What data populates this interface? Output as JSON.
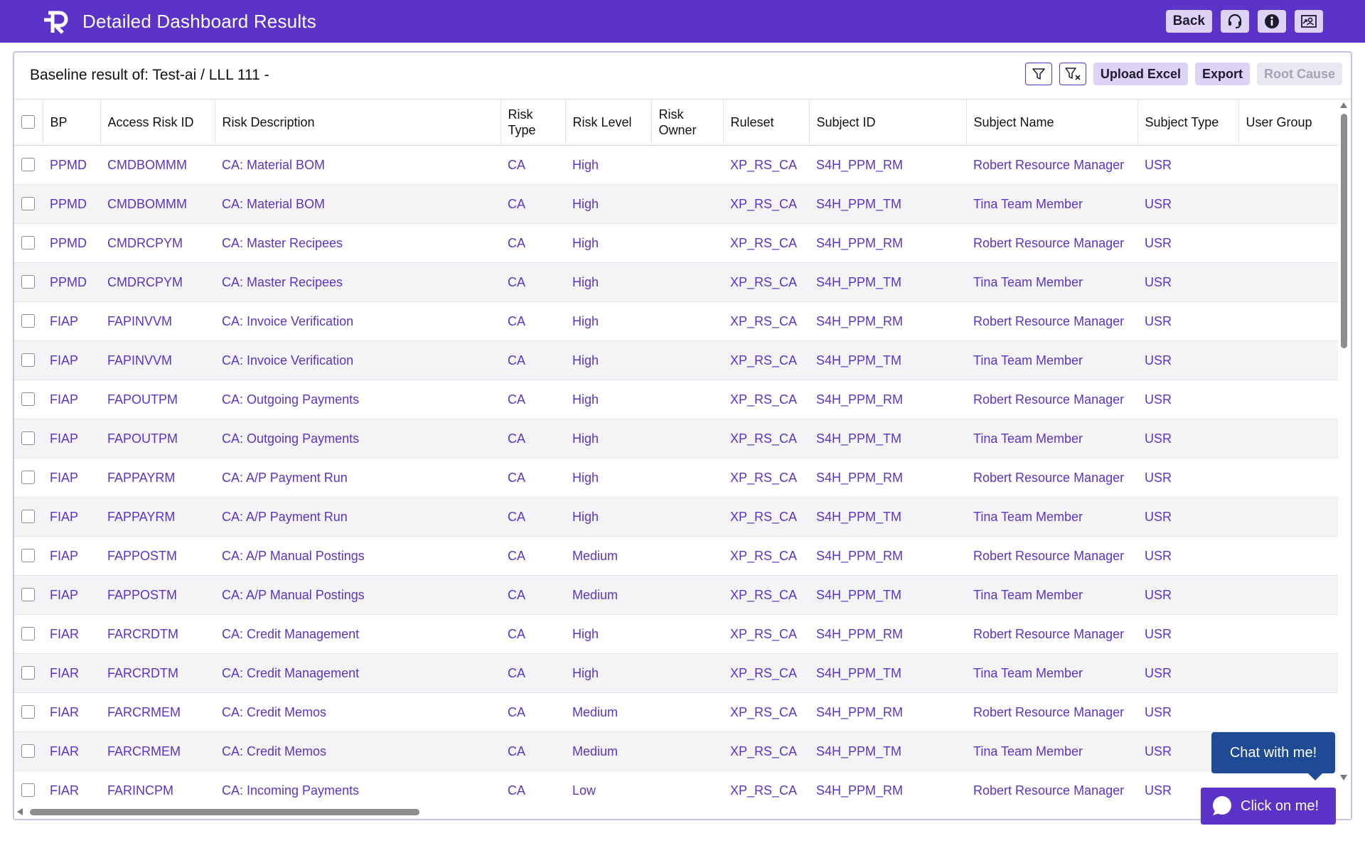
{
  "header": {
    "title": "Detailed Dashboard Results",
    "back_label": "Back"
  },
  "panel": {
    "title": "Baseline result of: Test-ai / LLL 111 -",
    "upload_label": "Upload Excel",
    "export_label": "Export",
    "root_cause_label": "Root Cause"
  },
  "table": {
    "columns": [
      "BP",
      "Access Risk ID",
      "Risk Description",
      "Risk Type",
      "Risk Level",
      "Risk Owner",
      "Ruleset",
      "Subject ID",
      "Subject Name",
      "Subject Type",
      "User Group"
    ],
    "rows": [
      [
        "PPMD",
        "CMDBOMMM",
        "CA: Material BOM",
        "CA",
        "High",
        "",
        "XP_RS_CA",
        "S4H_PPM_RM",
        "Robert Resource Manager",
        "USR",
        ""
      ],
      [
        "PPMD",
        "CMDBOMMM",
        "CA: Material BOM",
        "CA",
        "High",
        "",
        "XP_RS_CA",
        "S4H_PPM_TM",
        "Tina Team Member",
        "USR",
        ""
      ],
      [
        "PPMD",
        "CMDRCPYM",
        "CA: Master Recipees",
        "CA",
        "High",
        "",
        "XP_RS_CA",
        "S4H_PPM_RM",
        "Robert Resource Manager",
        "USR",
        ""
      ],
      [
        "PPMD",
        "CMDRCPYM",
        "CA: Master Recipees",
        "CA",
        "High",
        "",
        "XP_RS_CA",
        "S4H_PPM_TM",
        "Tina Team Member",
        "USR",
        ""
      ],
      [
        "FIAP",
        "FAPINVVM",
        "CA: Invoice Verification",
        "CA",
        "High",
        "",
        "XP_RS_CA",
        "S4H_PPM_RM",
        "Robert Resource Manager",
        "USR",
        ""
      ],
      [
        "FIAP",
        "FAPINVVM",
        "CA: Invoice Verification",
        "CA",
        "High",
        "",
        "XP_RS_CA",
        "S4H_PPM_TM",
        "Tina Team Member",
        "USR",
        ""
      ],
      [
        "FIAP",
        "FAPOUTPM",
        "CA: Outgoing Payments",
        "CA",
        "High",
        "",
        "XP_RS_CA",
        "S4H_PPM_RM",
        "Robert Resource Manager",
        "USR",
        ""
      ],
      [
        "FIAP",
        "FAPOUTPM",
        "CA: Outgoing Payments",
        "CA",
        "High",
        "",
        "XP_RS_CA",
        "S4H_PPM_TM",
        "Tina Team Member",
        "USR",
        ""
      ],
      [
        "FIAP",
        "FAPPAYRM",
        "CA: A/P Payment Run",
        "CA",
        "High",
        "",
        "XP_RS_CA",
        "S4H_PPM_RM",
        "Robert Resource Manager",
        "USR",
        ""
      ],
      [
        "FIAP",
        "FAPPAYRM",
        "CA: A/P Payment Run",
        "CA",
        "High",
        "",
        "XP_RS_CA",
        "S4H_PPM_TM",
        "Tina Team Member",
        "USR",
        ""
      ],
      [
        "FIAP",
        "FAPPOSTM",
        "CA: A/P Manual Postings",
        "CA",
        "Medium",
        "",
        "XP_RS_CA",
        "S4H_PPM_RM",
        "Robert Resource Manager",
        "USR",
        ""
      ],
      [
        "FIAP",
        "FAPPOSTM",
        "CA: A/P Manual Postings",
        "CA",
        "Medium",
        "",
        "XP_RS_CA",
        "S4H_PPM_TM",
        "Tina Team Member",
        "USR",
        ""
      ],
      [
        "FIAR",
        "FARCRDTM",
        "CA: Credit Management",
        "CA",
        "High",
        "",
        "XP_RS_CA",
        "S4H_PPM_RM",
        "Robert Resource Manager",
        "USR",
        ""
      ],
      [
        "FIAR",
        "FARCRDTM",
        "CA: Credit Management",
        "CA",
        "High",
        "",
        "XP_RS_CA",
        "S4H_PPM_TM",
        "Tina Team Member",
        "USR",
        ""
      ],
      [
        "FIAR",
        "FARCRMEM",
        "CA: Credit Memos",
        "CA",
        "Medium",
        "",
        "XP_RS_CA",
        "S4H_PPM_RM",
        "Robert Resource Manager",
        "USR",
        ""
      ],
      [
        "FIAR",
        "FARCRMEM",
        "CA: Credit Memos",
        "CA",
        "Medium",
        "",
        "XP_RS_CA",
        "S4H_PPM_TM",
        "Tina Team Member",
        "USR",
        ""
      ],
      [
        "FIAR",
        "FARINCPM",
        "CA: Incoming Payments",
        "CA",
        "Low",
        "",
        "XP_RS_CA",
        "S4H_PPM_RM",
        "Robert Resource Manager",
        "USR",
        ""
      ]
    ]
  },
  "chat": {
    "bubble_label": "Chat with me!",
    "button_label": "Click on me!"
  },
  "icons": {
    "logo": "r-logo-icon",
    "support": "headset-icon",
    "info": "info-icon",
    "switch": "switch-user-icon",
    "filter": "filter-icon",
    "clear_filter": "clear-filter-icon",
    "chat": "chat-icon"
  },
  "colors": {
    "brand": "#5b33c9",
    "button_bg": "#ddd3f7",
    "chat_bubble": "#1f4a94"
  }
}
